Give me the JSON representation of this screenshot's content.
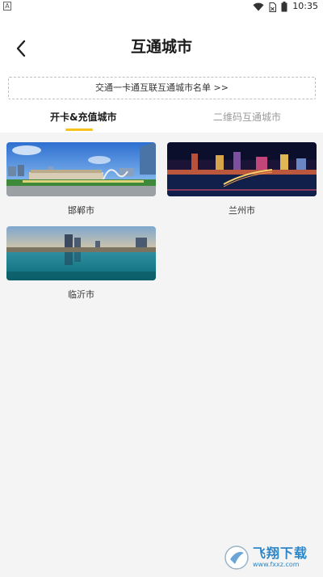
{
  "status_bar": {
    "left_indicator": "A",
    "time": "10:35",
    "icons": [
      "wifi-icon",
      "sim-icon",
      "battery-icon"
    ]
  },
  "header": {
    "back_icon": "chevron-left-icon",
    "title": "互通城市"
  },
  "notice": {
    "text": "交通一卡通互联互通城市名单 >>"
  },
  "tabs": [
    {
      "label": "开卡&充值城市",
      "active": true
    },
    {
      "label": "二维码互通城市",
      "active": false
    }
  ],
  "cities": [
    {
      "name": "邯郸市"
    },
    {
      "name": "兰州市"
    },
    {
      "name": "临沂市"
    }
  ],
  "watermark": {
    "main": "飞翔下载",
    "sub": "www.fxxz.com"
  },
  "colors": {
    "accent": "#f6c21c",
    "background": "#f4f4f4",
    "tab_inactive": "#9a9a9a"
  }
}
